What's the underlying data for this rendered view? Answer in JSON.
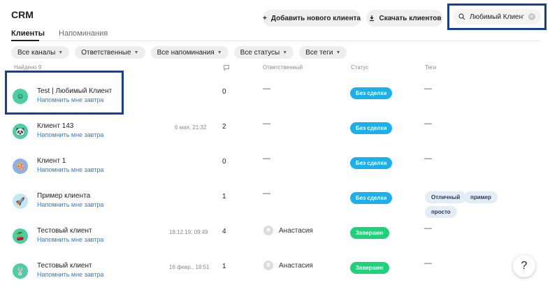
{
  "app": {
    "title": "CRM"
  },
  "tabs": [
    {
      "label": "Клиенты",
      "active": true
    },
    {
      "label": "Напоминания",
      "active": false
    }
  ],
  "toolbar": {
    "add_label": "Добавить нового клиента",
    "download_label": "Скачать клиентов"
  },
  "search": {
    "value": "Любимый Клиент"
  },
  "filters": [
    {
      "label": "Все каналы"
    },
    {
      "label": "Ответственные"
    },
    {
      "label": "Все напоминания"
    },
    {
      "label": "Все статусы"
    },
    {
      "label": "Все теги"
    }
  ],
  "table": {
    "found": "Найдено 9",
    "columns": {
      "responsible": "Ответственный",
      "status": "Статус",
      "tags": "Теги"
    },
    "rows": [
      {
        "name": "Test | Любимый Клиент",
        "reminder": "Напомнить мне завтра",
        "date": "",
        "count": "0",
        "responsible": "—",
        "status": "Без сделки",
        "status_color": "#1ab0ee",
        "tags_empty": "—",
        "tags": [],
        "avatar_icon": "smiley-icon",
        "avatar_color": "#4ccfa0"
      },
      {
        "name": "Клиент 143",
        "reminder": "Напомнить мне завтра",
        "date": "6 мая, 21:32",
        "count": "2",
        "responsible": "—",
        "status": "Без сделки",
        "status_color": "#1ab0ee",
        "tags_empty": "—",
        "tags": [],
        "avatar_icon": "panda-icon",
        "avatar_color": "#4ccfa0"
      },
      {
        "name": "Клиент 1",
        "reminder": "Напомнить мне завтра",
        "date": "",
        "count": "0",
        "responsible": "—",
        "status": "Без сделки",
        "status_color": "#1ab0ee",
        "tags_empty": "—",
        "tags": [],
        "avatar_icon": "pizza-icon",
        "avatar_color": "#8fb0e6"
      },
      {
        "name": "Пример клиента",
        "reminder": "Напомнить мне завтра",
        "date": "",
        "count": "1",
        "responsible": "—",
        "status": "Без сделки",
        "status_color": "#1ab0ee",
        "tags_empty": "",
        "tags": [
          "Отличный",
          "пример",
          "просто"
        ],
        "avatar_icon": "rocket-icon",
        "avatar_color": "#bfe9f5"
      },
      {
        "name": "Тестовый клиент",
        "reminder": "Напомнить мне завтра",
        "date": "18.12.19, 09:49",
        "count": "4",
        "responsible": "Анастасия",
        "status": "Завершен",
        "status_color": "#1ed27a",
        "tags_empty": "—",
        "tags": [],
        "avatar_icon": "cherry-icon",
        "avatar_color": "#4ccfa0"
      },
      {
        "name": "Тестовый клиент",
        "reminder": "Напомнить мне завтра",
        "date": "16 февр., 18:51",
        "count": "1",
        "responsible": "Анастасия",
        "status": "Завершен",
        "status_color": "#1ed27a",
        "tags_empty": "—",
        "tags": [],
        "avatar_icon": "bunny-icon",
        "avatar_color": "#4ccfa0"
      }
    ]
  },
  "help": {
    "label": "?"
  }
}
